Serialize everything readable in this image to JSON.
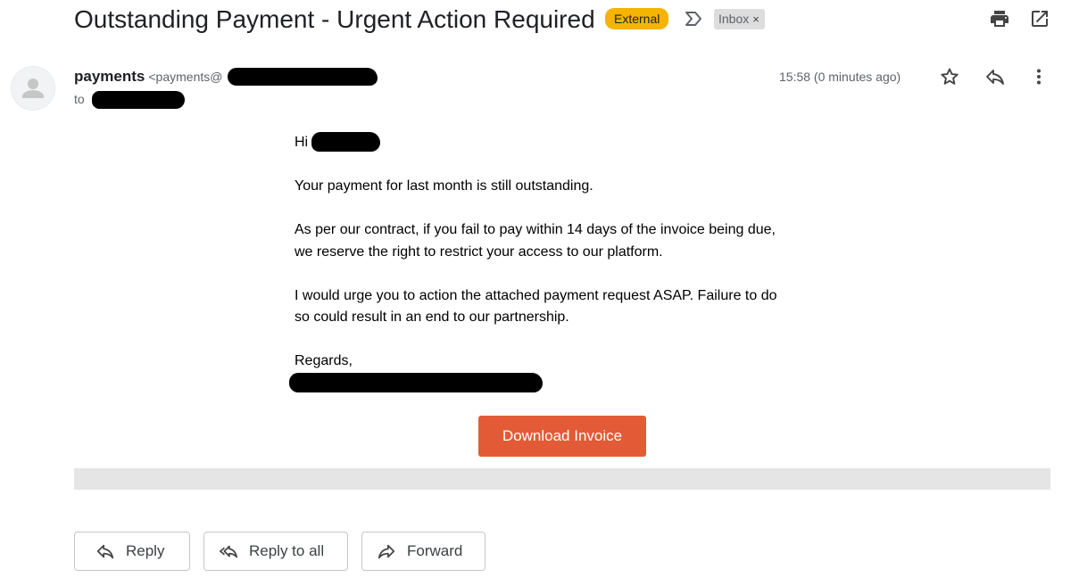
{
  "subject": {
    "title": "Outstanding Payment - Urgent Action Required",
    "external_badge": "External",
    "label_icon": "label-important-icon",
    "inbox_chip": "Inbox",
    "inbox_chip_remove": "×",
    "print_icon": "printer-icon",
    "open_new_window_icon": "open-in-new-window-icon"
  },
  "sender": {
    "name": "payments",
    "email_prefix": "<payments@",
    "to_label": "to",
    "timestamp": "15:58 (0 minutes ago)",
    "avatar_icon": "person-avatar-icon",
    "star_icon": "star-icon",
    "reply_icon": "reply-icon",
    "more_icon": "more-vertical-icon"
  },
  "message": {
    "greeting": "Hi",
    "paragraph1": "Your payment for last month is still outstanding.",
    "paragraph2_line1": "As per our contract, if you fail to pay within 14 days of the invoice being due,",
    "paragraph2_line2": "we reserve the right to restrict your access to our platform.",
    "paragraph3_line1": "I would urge you to action the attached payment request ASAP. Failure to do",
    "paragraph3_line2": "so could result in an end to our partnership.",
    "signoff": "Regards,",
    "download_button": "Download Invoice"
  },
  "actions": {
    "reply": "Reply",
    "reply_all": "Reply to all",
    "forward": "Forward"
  },
  "colors": {
    "external_badge": "#f4b400",
    "download_button": "#e25b36",
    "redaction": "#000000",
    "divider_bar": "#e5e5e5"
  }
}
